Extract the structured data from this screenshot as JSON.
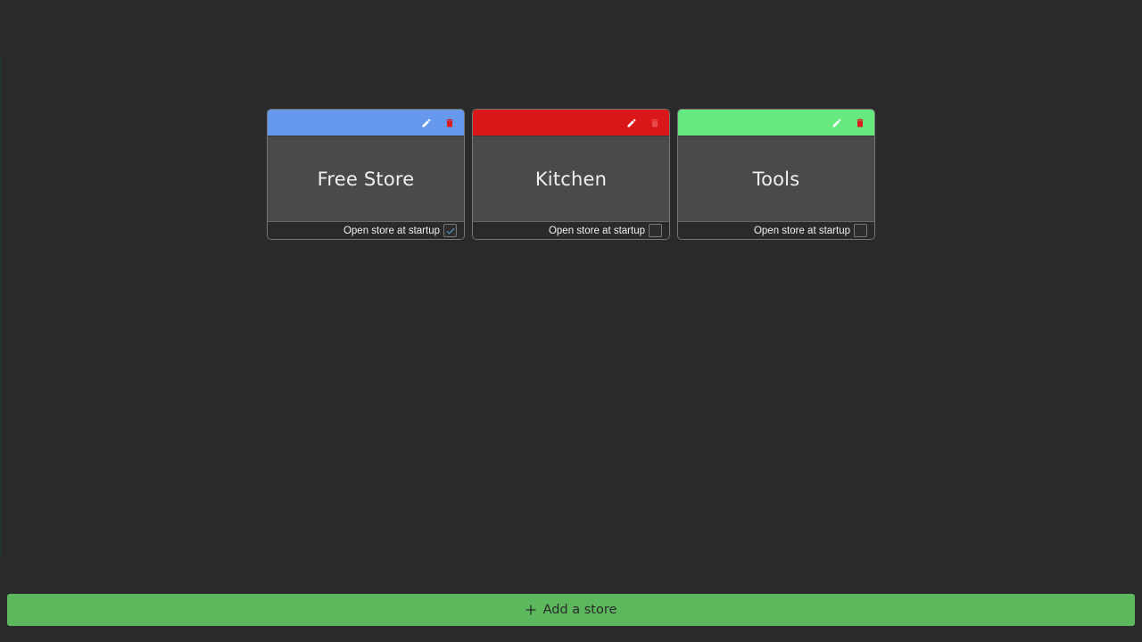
{
  "colors": {
    "background": "#2a2a2a",
    "card_body": "#4a4a4a",
    "add_button": "#5cb85c",
    "delete_icon": "#d9191b",
    "edit_icon": "#ffffff",
    "check_mark": "#4fa7e0"
  },
  "stores": [
    {
      "name": "Free Store",
      "color": "#6699ee",
      "edit_icon": "pencil-icon",
      "delete_icon": "trash-icon",
      "delete_icon_color": "#d9191b",
      "edit_icon_color": "#ffffff",
      "startup_label": "Open store at startup",
      "open_at_startup": true
    },
    {
      "name": "Kitchen",
      "color": "#d91618",
      "edit_icon": "pencil-icon",
      "delete_icon": "trash-icon",
      "delete_icon_color": "#e84a4a",
      "edit_icon_color": "#ffffff",
      "startup_label": "Open store at startup",
      "open_at_startup": false
    },
    {
      "name": "Tools",
      "color": "#66e97e",
      "edit_icon": "pencil-icon",
      "delete_icon": "trash-icon",
      "delete_icon_color": "#d9191b",
      "edit_icon_color": "#ffffff",
      "startup_label": "Open store at startup",
      "open_at_startup": false
    }
  ],
  "add_store": {
    "icon": "plus-icon",
    "label": "Add a store"
  }
}
